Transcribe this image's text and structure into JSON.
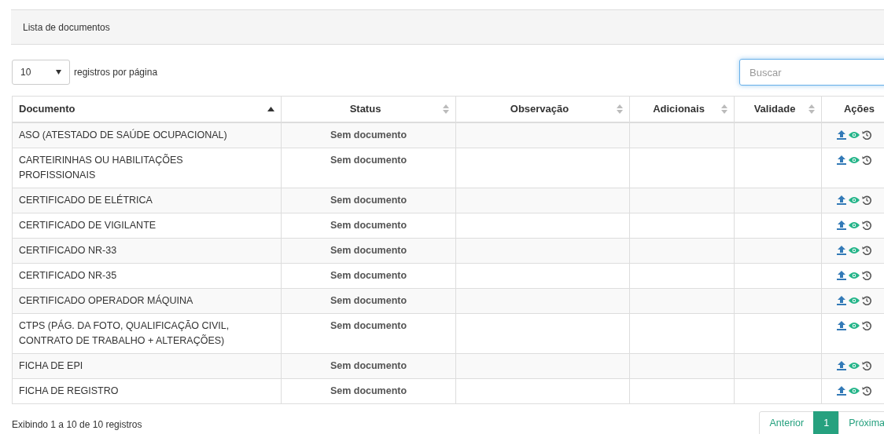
{
  "panel": {
    "title": "Lista de documentos"
  },
  "page_size": {
    "value": "10",
    "label": "registros por página"
  },
  "search": {
    "placeholder": "Buscar"
  },
  "columns": [
    {
      "label": "Documento",
      "sortable": true,
      "sorted": true
    },
    {
      "label": "Status",
      "sortable": true,
      "sorted": false
    },
    {
      "label": "Observação",
      "sortable": true,
      "sorted": false
    },
    {
      "label": "Adicionais",
      "sortable": true,
      "sorted": false
    },
    {
      "label": "Validade",
      "sortable": true,
      "sorted": false
    },
    {
      "label": "Ações",
      "sortable": false
    }
  ],
  "rows": [
    {
      "documento": "ASO (ATESTADO DE SAÚDE OCUPACIONAL)",
      "status": "Sem documento"
    },
    {
      "documento": "CARTEIRINHAS OU HABILITAÇÕES PROFISSIONAIS",
      "status": "Sem documento"
    },
    {
      "documento": "CERTIFICADO DE ELÉTRICA",
      "status": "Sem documento"
    },
    {
      "documento": "CERTIFICADO DE VIGILANTE",
      "status": "Sem documento"
    },
    {
      "documento": "CERTIFICADO NR-33",
      "status": "Sem documento"
    },
    {
      "documento": "CERTIFICADO NR-35",
      "status": "Sem documento"
    },
    {
      "documento": "CERTIFICADO OPERADOR MÁQUINA",
      "status": "Sem documento"
    },
    {
      "documento": "CTPS (PÁG. DA FOTO, QUALIFICAÇÃO CIVIL, CONTRATO DE TRABALHO + ALTERAÇÕES)",
      "status": "Sem documento"
    },
    {
      "documento": "FICHA DE EPI",
      "status": "Sem documento"
    },
    {
      "documento": "FICHA DE REGISTRO",
      "status": "Sem documento"
    }
  ],
  "footer": {
    "info": "Exibindo 1 a 10 de 10 registros"
  },
  "pagination": [
    {
      "label": "Anterior",
      "selected": false
    },
    {
      "label": "1",
      "selected": true
    },
    {
      "label": "Próxima",
      "selected": false
    }
  ]
}
